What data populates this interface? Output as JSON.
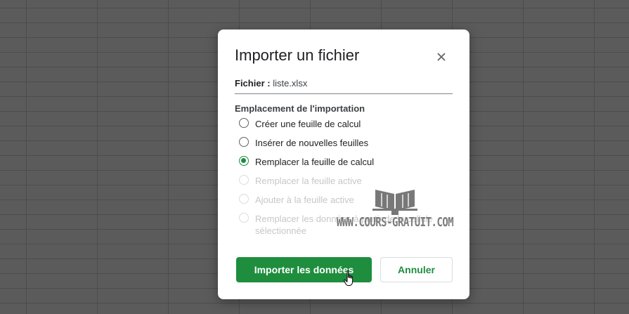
{
  "dialog": {
    "title": "Importer un fichier",
    "close_icon": "close-icon"
  },
  "file": {
    "label": "Fichier :",
    "name": "liste.xlsx"
  },
  "import_location": {
    "label": "Emplacement de l'importation",
    "options": [
      {
        "label": "Créer une feuille de calcul",
        "selected": false,
        "enabled": true
      },
      {
        "label": "Insérer de nouvelles feuilles",
        "selected": false,
        "enabled": true
      },
      {
        "label": "Remplacer la feuille de calcul",
        "selected": true,
        "enabled": true
      },
      {
        "label": "Remplacer la feuille active",
        "selected": false,
        "enabled": false
      },
      {
        "label": "Ajouter à la feuille active",
        "selected": false,
        "enabled": false
      },
      {
        "label": "Remplacer les données à partir de la cellule sélectionnée",
        "selected": false,
        "enabled": false
      }
    ]
  },
  "buttons": {
    "import_label": "Importer les données",
    "cancel_label": "Annuler"
  },
  "watermark": {
    "text": "WWW.COURS-GRATUIT.COM"
  },
  "colors": {
    "accent": "#1e8e3e",
    "backdrop": "#5b5b5b",
    "disabled_text": "#c7c7c7"
  }
}
